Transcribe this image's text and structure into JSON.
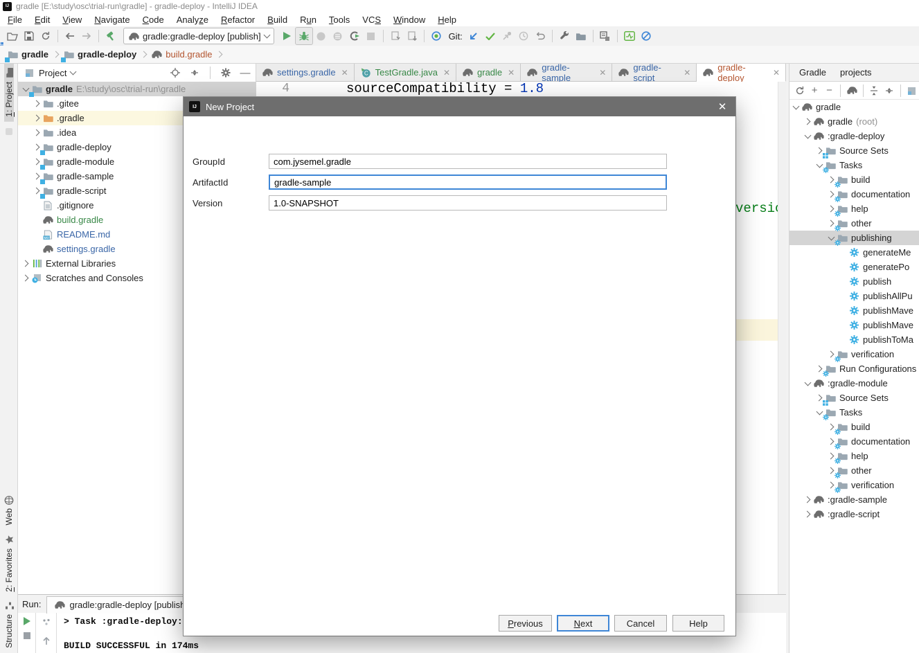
{
  "window": {
    "title": "gradle [E:\\study\\osc\\trial-run\\gradle] - gradle-deploy - IntelliJ IDEA"
  },
  "menubar": {
    "items": [
      {
        "label": "File",
        "u": 0
      },
      {
        "label": "Edit",
        "u": 0
      },
      {
        "label": "View",
        "u": 0
      },
      {
        "label": "Navigate",
        "u": 0
      },
      {
        "label": "Code",
        "u": 0
      },
      {
        "label": "Analyze",
        "u": 5
      },
      {
        "label": "Refactor",
        "u": 0
      },
      {
        "label": "Build",
        "u": 0
      },
      {
        "label": "Run",
        "u": 1
      },
      {
        "label": "Tools",
        "u": 0
      },
      {
        "label": "VCS",
        "u": 2
      },
      {
        "label": "Window",
        "u": 0
      },
      {
        "label": "Help",
        "u": 0
      }
    ]
  },
  "toolbar": {
    "run_config": "gradle:gradle-deploy [publish]",
    "git_label": "Git:",
    "items": [
      {
        "icon": "open"
      },
      {
        "icon": "save"
      },
      {
        "icon": "sync"
      },
      {
        "sep": true
      },
      {
        "icon": "back"
      },
      {
        "icon": "forward"
      },
      {
        "sep": true
      },
      {
        "icon": "hammer"
      },
      {
        "combo": true
      },
      {
        "icon": "run"
      },
      {
        "icon": "debug",
        "boxed": true
      },
      {
        "icon": "coverage-circle"
      },
      {
        "icon": "profiler-circle"
      },
      {
        "icon": "run-coverage"
      },
      {
        "icon": "stop-dim"
      },
      {
        "sep": true
      },
      {
        "icon": "tool1"
      },
      {
        "icon": "tool2"
      },
      {
        "sep": true
      },
      {
        "icon": "updates"
      },
      {
        "gitlabel": true
      },
      {
        "icon": "git-update"
      },
      {
        "icon": "git-commit"
      },
      {
        "icon": "git-merge"
      },
      {
        "icon": "git-history"
      },
      {
        "icon": "git-rollback"
      },
      {
        "sep": true
      },
      {
        "icon": "wrench"
      },
      {
        "icon": "project-structure"
      },
      {
        "sep": true
      },
      {
        "icon": "sync-settings"
      },
      {
        "sep": true
      },
      {
        "icon": "monitor"
      },
      {
        "icon": "prohibit"
      }
    ]
  },
  "breadcrumbs": {
    "items": [
      {
        "label": "gradle",
        "icon": "folder-module",
        "bold": true,
        "color": "#1f1f1f"
      },
      {
        "label": "gradle-deploy",
        "icon": "folder-module",
        "bold": true,
        "color": "#1f1f1f"
      },
      {
        "label": "build.gradle",
        "icon": "gradle",
        "bold": false,
        "color": "#b3542e"
      }
    ]
  },
  "activity_bar": {
    "top": [
      {
        "label": "1: Project",
        "u": 0,
        "icon": "folder-small",
        "active": true
      },
      {
        "label": "",
        "icon": "stub"
      }
    ],
    "bottom": [
      {
        "label": "Web",
        "icon": "globe"
      },
      {
        "label": "2: Favorites",
        "u": 0,
        "icon": "star"
      },
      {
        "label": "Structure",
        "icon": "structure"
      }
    ]
  },
  "project_panel": {
    "title": "Project",
    "rows": [
      {
        "indent": 0,
        "chevron": "down",
        "icon": "folder-module",
        "label": "gradle",
        "bold": true,
        "path": "E:\\study\\osc\\trial-run\\gradle",
        "selected": true
      },
      {
        "indent": 1,
        "chevron": "right",
        "icon": "folder-grey",
        "label": ".gitee"
      },
      {
        "indent": 1,
        "chevron": "right",
        "icon": "folder-orange",
        "label": ".gradle",
        "highlight": true
      },
      {
        "indent": 1,
        "chevron": "right",
        "icon": "folder-grey",
        "label": ".idea"
      },
      {
        "indent": 1,
        "chevron": "right",
        "icon": "folder-module",
        "label": "gradle-deploy"
      },
      {
        "indent": 1,
        "chevron": "right",
        "icon": "folder-module",
        "label": "gradle-module"
      },
      {
        "indent": 1,
        "chevron": "right",
        "icon": "folder-module",
        "label": "gradle-sample"
      },
      {
        "indent": 1,
        "chevron": "right",
        "icon": "folder-module",
        "label": "gradle-script"
      },
      {
        "indent": 1,
        "chevron": null,
        "icon": "file",
        "label": ".gitignore"
      },
      {
        "indent": 1,
        "chevron": null,
        "icon": "gradle",
        "label": "build.gradle",
        "color": "#378746"
      },
      {
        "indent": 1,
        "chevron": null,
        "icon": "md",
        "label": "README.md",
        "color": "#3a66a7"
      },
      {
        "indent": 1,
        "chevron": null,
        "icon": "gradle",
        "label": "settings.gradle",
        "color": "#3a66a7"
      },
      {
        "indent": 0,
        "chevron": "right",
        "icon": "lib",
        "label": "External Libraries"
      },
      {
        "indent": 0,
        "chevron": "right",
        "icon": "scratch",
        "label": "Scratches and Consoles"
      }
    ]
  },
  "editor": {
    "tabs": [
      {
        "label": "settings.gradle",
        "icon": "gradle",
        "color": "#3a66a7"
      },
      {
        "label": "TestGradle.java",
        "icon": "class",
        "color": "#378746"
      },
      {
        "label": "gradle",
        "icon": "gradle",
        "color": "#378746"
      },
      {
        "label": "gradle-sample",
        "icon": "gradle",
        "color": "#3a66a7"
      },
      {
        "label": "gradle-script",
        "icon": "gradle",
        "color": "#3a66a7"
      },
      {
        "label": "gradle-deploy",
        "icon": "gradle",
        "color": "#b3542e",
        "active": true
      }
    ],
    "line_number": "4",
    "code": [
      {
        "text": "sourceCompatibility = ",
        "color": "#000000"
      },
      {
        "text": "1.8",
        "color": "#0033b3"
      }
    ],
    "side_string": {
      "text": "versio",
      "color": "#067d17"
    }
  },
  "gradle_panel": {
    "tabs": [
      "Gradle",
      "projects"
    ],
    "toolbar_icons": [
      "sync",
      "plus",
      "minus",
      "sep",
      "gradle",
      "sep",
      "expand-all",
      "collapse-all",
      "sep",
      "settings-cut"
    ],
    "rows": [
      {
        "indent": 0,
        "chevron": "down",
        "icon": "gradle",
        "label": "gradle"
      },
      {
        "indent": 1,
        "chevron": "right",
        "icon": "gradle",
        "label": "gradle",
        "grey": "(root)"
      },
      {
        "indent": 1,
        "chevron": "down",
        "icon": "gradle",
        "label": ":gradle-deploy"
      },
      {
        "indent": 2,
        "chevron": "right",
        "icon": "folder-src",
        "label": "Source Sets"
      },
      {
        "indent": 2,
        "chevron": "down",
        "icon": "folder-tasks",
        "label": "Tasks"
      },
      {
        "indent": 3,
        "chevron": "right",
        "icon": "folder-tasks",
        "label": "build"
      },
      {
        "indent": 3,
        "chevron": "right",
        "icon": "folder-tasks",
        "label": "documentation"
      },
      {
        "indent": 3,
        "chevron": "right",
        "icon": "folder-tasks",
        "label": "help"
      },
      {
        "indent": 3,
        "chevron": "right",
        "icon": "folder-tasks",
        "label": "other"
      },
      {
        "indent": 3,
        "chevron": "down",
        "icon": "folder-tasks",
        "label": "publishing",
        "selected": true
      },
      {
        "indent": 4,
        "chevron": null,
        "icon": "gear",
        "label": "generateMe"
      },
      {
        "indent": 4,
        "chevron": null,
        "icon": "gear",
        "label": "generatePo"
      },
      {
        "indent": 4,
        "chevron": null,
        "icon": "gear",
        "label": "publish"
      },
      {
        "indent": 4,
        "chevron": null,
        "icon": "gear",
        "label": "publishAllPu"
      },
      {
        "indent": 4,
        "chevron": null,
        "icon": "gear",
        "label": "publishMave"
      },
      {
        "indent": 4,
        "chevron": null,
        "icon": "gear",
        "label": "publishMave"
      },
      {
        "indent": 4,
        "chevron": null,
        "icon": "gear",
        "label": "publishToMa"
      },
      {
        "indent": 3,
        "chevron": "right",
        "icon": "folder-tasks",
        "label": "verification"
      },
      {
        "indent": 2,
        "chevron": "right",
        "icon": "folder-tasks",
        "label": "Run Configurations"
      },
      {
        "indent": 1,
        "chevron": "down",
        "icon": "gradle",
        "label": ":gradle-module"
      },
      {
        "indent": 2,
        "chevron": "right",
        "icon": "folder-src",
        "label": "Source Sets"
      },
      {
        "indent": 2,
        "chevron": "down",
        "icon": "folder-tasks",
        "label": "Tasks"
      },
      {
        "indent": 3,
        "chevron": "right",
        "icon": "folder-tasks",
        "label": "build"
      },
      {
        "indent": 3,
        "chevron": "right",
        "icon": "folder-tasks",
        "label": "documentation"
      },
      {
        "indent": 3,
        "chevron": "right",
        "icon": "folder-tasks",
        "label": "help"
      },
      {
        "indent": 3,
        "chevron": "right",
        "icon": "folder-tasks",
        "label": "other"
      },
      {
        "indent": 3,
        "chevron": "right",
        "icon": "folder-tasks",
        "label": "verification"
      },
      {
        "indent": 1,
        "chevron": "right",
        "icon": "gradle",
        "label": ":gradle-sample"
      },
      {
        "indent": 1,
        "chevron": "right",
        "icon": "gradle",
        "label": ":gradle-script"
      }
    ]
  },
  "run_panel": {
    "label": "Run:",
    "tab": "gradle:gradle-deploy [publish]",
    "console_lines": [
      "> Task :gradle-deploy:publish",
      "BUILD SUCCESSFUL in 174ms"
    ]
  },
  "dialog": {
    "title": "New Project",
    "fields": [
      {
        "label": "GroupId",
        "value": "com.jysemel.gradle",
        "focused": false
      },
      {
        "label": "ArtifactId",
        "value": "gradle-sample",
        "focused": true
      },
      {
        "label": "Version",
        "value": "1.0-SNAPSHOT",
        "focused": false
      }
    ],
    "buttons": [
      {
        "label": "Previous",
        "u": 0
      },
      {
        "label": "Next",
        "u": 0,
        "default": true
      },
      {
        "label": "Cancel"
      },
      {
        "label": "Help"
      }
    ]
  },
  "colors": {
    "accent": "#3e86d6",
    "selection": "#d4d4d4",
    "task_blue": "#3fb0e3",
    "folder_grey": "#9ba8b2",
    "folder_orange": "#e8a45e",
    "vcs_green": "#378746",
    "vcs_blue": "#3a66a7",
    "vcs_orange": "#b3542e",
    "string_green": "#067d17",
    "number_blue": "#0033b3",
    "run_green": "#59a869",
    "highlight_row": "#fcf8e0",
    "highlight_band": "#fbf5dc",
    "dialog_titlebar": "#6e6e6e"
  }
}
